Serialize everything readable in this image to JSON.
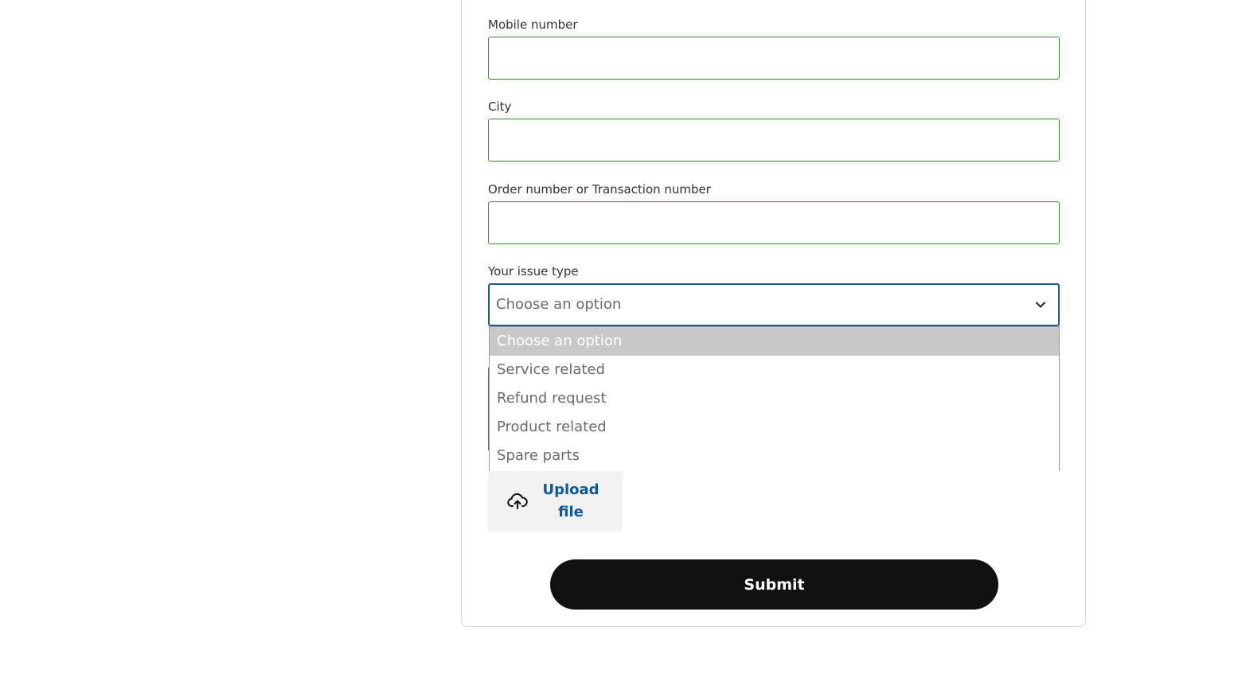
{
  "form": {
    "fields": [
      {
        "label": "Mobile number",
        "value": ""
      },
      {
        "label": "City",
        "value": ""
      },
      {
        "label": "Order number or Transaction number",
        "value": ""
      }
    ],
    "issue_type": {
      "label": "Your issue type",
      "selected": "Choose an option",
      "options": [
        "Choose an option",
        "Service related",
        "Refund request",
        "Product related",
        "Spare parts"
      ]
    },
    "upload": {
      "label": "Upload file",
      "icon": "cloud-upload-icon"
    },
    "submit_label": "Submit"
  },
  "colors": {
    "input_border": "#3a8a2e",
    "select_focus_border": "#1d5b94",
    "upload_text": "#0a5a99",
    "submit_bg": "#111111",
    "option_highlight": "#c8c8c8"
  }
}
